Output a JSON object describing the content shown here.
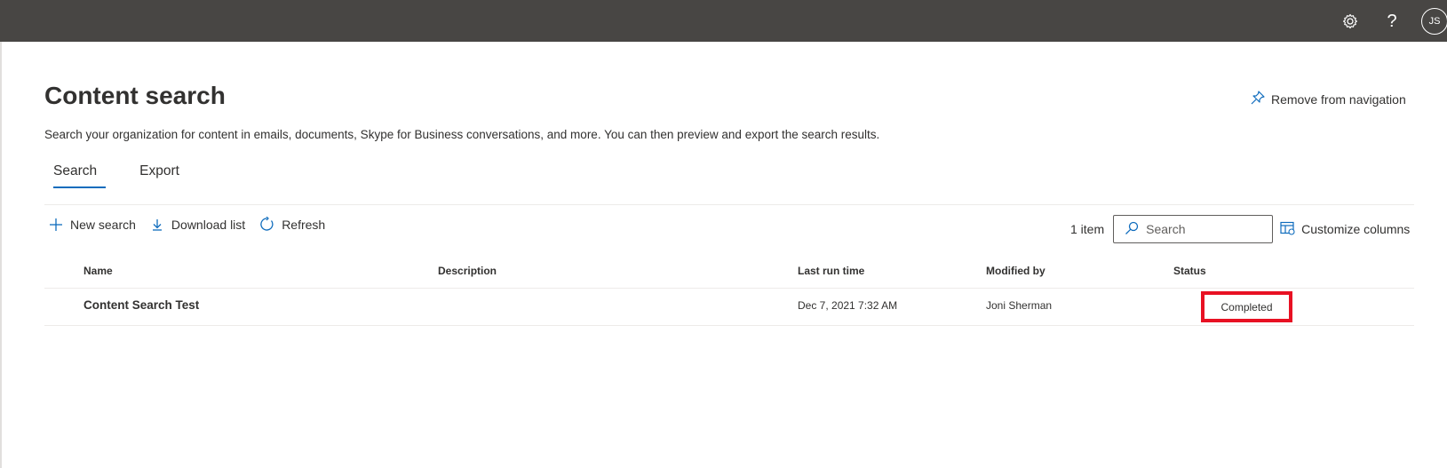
{
  "topbar": {
    "avatar_initials": "JS",
    "icons": [
      "gear-icon",
      "help-icon"
    ]
  },
  "page": {
    "title": "Content search",
    "subtitle": "Search your organization for content in emails, documents, Skype for Business conversations, and more. You can then preview and export the search results.",
    "remove_nav_label": "Remove from navigation"
  },
  "tabs": [
    {
      "label": "Search",
      "active": true
    },
    {
      "label": "Export",
      "active": false
    }
  ],
  "commands": {
    "new_search": "New search",
    "download_list": "Download list",
    "refresh": "Refresh",
    "item_count": "1 item",
    "search_placeholder": "Search",
    "customize_columns": "Customize columns"
  },
  "table": {
    "columns": [
      "Name",
      "Description",
      "Last run time",
      "Modified by",
      "Status"
    ],
    "rows": [
      {
        "name": "Content Search Test",
        "description": "",
        "last_run_time": "Dec 7, 2021 7:32 AM",
        "modified_by": "Joni Sherman",
        "status": "Completed"
      }
    ]
  },
  "colors": {
    "topbar": "#484644",
    "accent": "#0f6cbd",
    "highlight": "#e81123"
  }
}
